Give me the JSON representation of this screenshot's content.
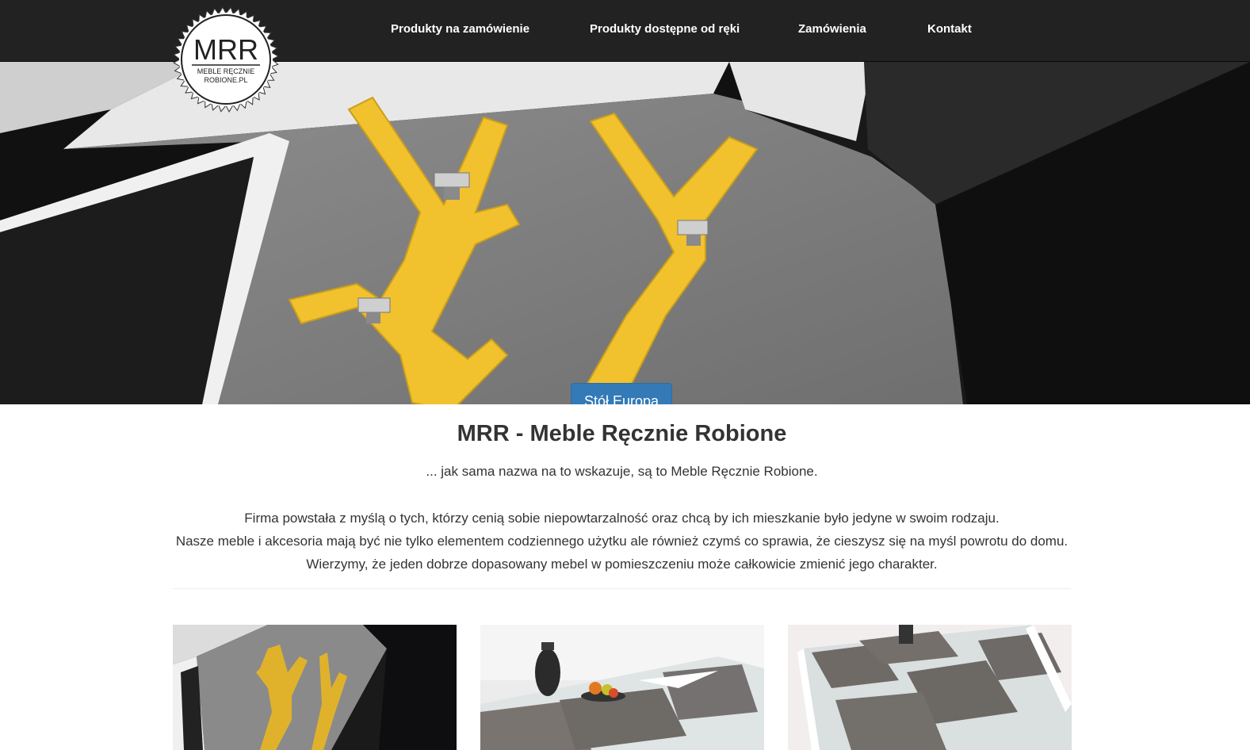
{
  "nav": {
    "logo_text": "MRR",
    "logo_subtext_1": "MEBLE RĘCZNIE",
    "logo_subtext_2": "ROBIONE.PL",
    "items": [
      {
        "label": "Produkty na zamówienie"
      },
      {
        "label": "Produkty dostępne od ręki"
      },
      {
        "label": "Zamówienia"
      },
      {
        "label": "Kontakt"
      }
    ]
  },
  "carousel": {
    "caption": "Stół Europa",
    "slide_count": 3,
    "active_slide": 1
  },
  "main": {
    "title": "MRR - Meble Ręcznie Robione",
    "lead": "... jak sama nazwa na to wskazuje, są to Meble Ręcznie Robione.",
    "paragraphs": [
      "Firma powstała z myślą o tych, którzy cenią sobie niepowtarzalność oraz chcą by ich mieszkanie było jedyne w swoim rodzaju.",
      "Nasze meble i akcesoria mają być nie tylko elementem codziennego użytku ale również czymś co sprawia, że cieszysz się na myśl powrotu do domu.",
      "Wierzymy, że jeden dobrze dopasowany mebel w pomieszczeniu może całkowicie zmienić jego charakter."
    ]
  },
  "colors": {
    "navbar": "#222222",
    "primary_button": "#337ab7",
    "coat_rack_yellow": "#f2c12e",
    "text": "#333333"
  },
  "thumbnails": [
    {
      "icon": "coat-rack-photo"
    },
    {
      "icon": "table-vase-photo"
    },
    {
      "icon": "table-placemats-photo"
    }
  ]
}
